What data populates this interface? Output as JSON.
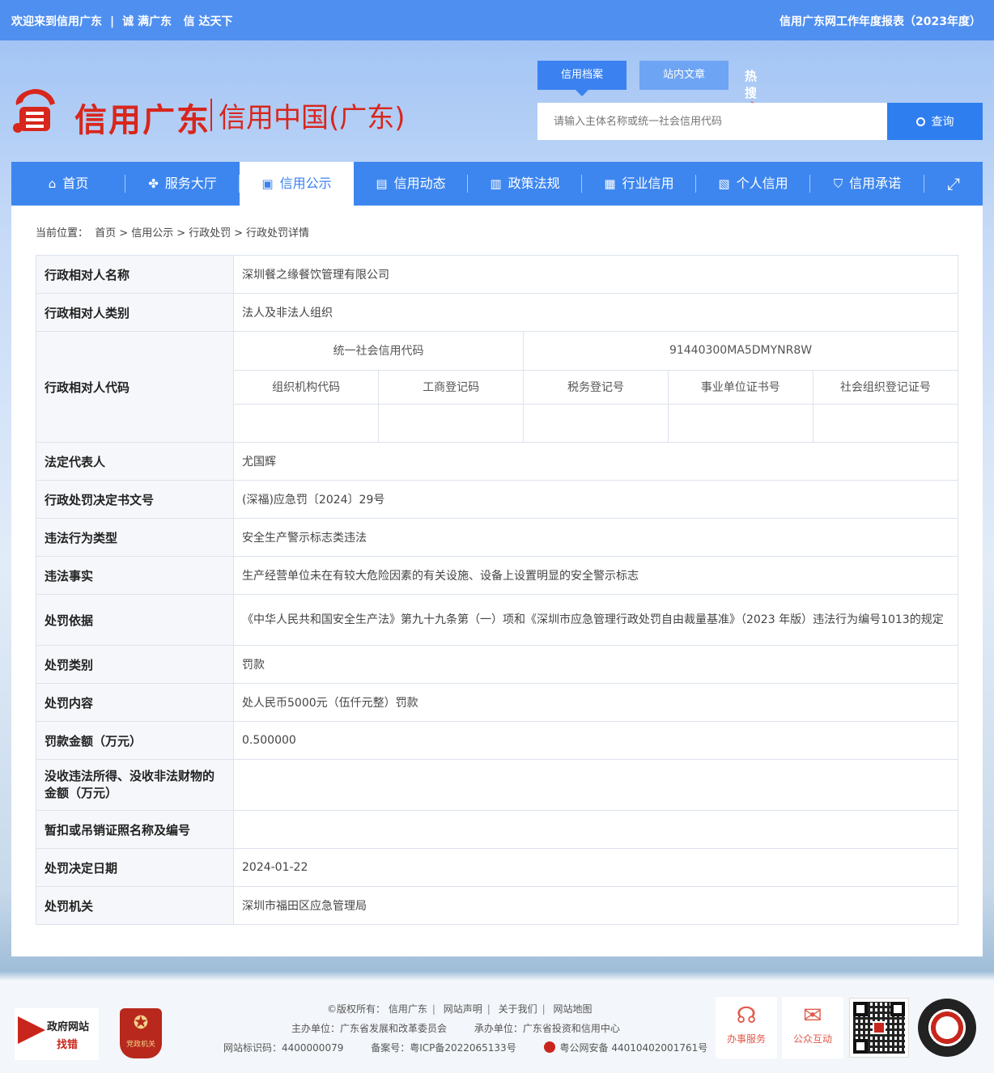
{
  "topbar": {
    "welcome": "欢迎来到信用广东",
    "slogan1": "诚 满广东",
    "slogan2": "信 达天下",
    "report_link": "信用广东网工作年度报表（2023年度）"
  },
  "logo": {
    "name": "信用广东",
    "sub": "信用中国(广东)"
  },
  "search": {
    "tab_active": "信用档案",
    "tab_other": "站内文章",
    "hot": "热搜",
    "placeholder": "请输入主体名称或统一社会信用代码",
    "button": "查询"
  },
  "nav": {
    "items": [
      {
        "label": "首页",
        "icon": "home-icon",
        "glyph": "⌂"
      },
      {
        "label": "服务大厅",
        "icon": "grid-icon",
        "glyph": "✤"
      },
      {
        "label": "信用公示",
        "icon": "briefcase-icon",
        "glyph": "▣"
      },
      {
        "label": "信用动态",
        "icon": "document-icon",
        "glyph": "▤"
      },
      {
        "label": "政策法规",
        "icon": "clipboard-icon",
        "glyph": "▥"
      },
      {
        "label": "行业信用",
        "icon": "building-icon",
        "glyph": "▦"
      },
      {
        "label": "个人信用",
        "icon": "id-card-icon",
        "glyph": "▧"
      },
      {
        "label": "信用承诺",
        "icon": "shield-icon",
        "glyph": "⛉"
      }
    ],
    "expand_icon": "expand-icon",
    "expand_glyph": "⤢"
  },
  "breadcrumb": {
    "prefix": "当前位置：",
    "items": [
      "首页",
      "信用公示",
      "行政处罚",
      "行政处罚详情"
    ],
    "sep": ">"
  },
  "record": {
    "name_label": "行政相对人名称",
    "name": "深圳餐之缘餐饮管理有限公司",
    "type_label": "行政相对人类别",
    "type": "法人及非法人组织",
    "code_label": "行政相对人代码",
    "uscc_label": "统一社会信用代码",
    "uscc": "91440300MA5DMYNR8W",
    "org_code_label": "组织机构代码",
    "biz_reg_label": "工商登记码",
    "tax_reg_label": "税务登记号",
    "inst_cert_label": "事业单位证书号",
    "social_org_label": "社会组织登记证号",
    "org_code": "",
    "biz_reg": "",
    "tax_reg": "",
    "inst_cert": "",
    "social_org": "",
    "legal_rep_label": "法定代表人",
    "legal_rep": "尤国辉",
    "doc_no_label": "行政处罚决定书文号",
    "doc_no": "(深福)应急罚〔2024〕29号",
    "violation_type_label": "违法行为类型",
    "violation_type": "安全生产警示标志类违法",
    "facts_label": "违法事实",
    "facts": "生产经营单位未在有较大危险因素的有关设施、设备上设置明显的安全警示标志",
    "basis_label": "处罚依据",
    "basis": "《中华人民共和国安全生产法》第九十九条第（一）项和《深圳市应急管理行政处罚自由裁量基准》（2023 年版）违法行为编号1013的规定",
    "category_label": "处罚类别",
    "category": "罚款",
    "content_label": "处罚内容",
    "content": "处人民币5000元（伍仟元整）罚款",
    "amount_label": "罚款金额（万元）",
    "amount": "0.500000",
    "confiscated_label": "没收违法所得、没收非法财物的金额（万元）",
    "confiscated": "",
    "license_label": "暂扣或吊销证照名称及编号",
    "license": "",
    "date_label": "处罚决定日期",
    "date": "2024-01-22",
    "authority_label": "处罚机关",
    "authority": "深圳市福田区应急管理局"
  },
  "footer": {
    "gov_find_1": "政府网站",
    "gov_find_2": "找错",
    "party_label": "党政机关",
    "copyright": "©版权所有：",
    "links": [
      "信用广东",
      "网站声明",
      "关于我们",
      "网站地图"
    ],
    "sponsor": "主办单位：广东省发展和改革委员会",
    "operator": "承办单位：广东省投资和信用中心",
    "site_id": "网站标识码：4400000079",
    "icp": "备案号：粤ICP备2022065133号",
    "police": "粤公网安备 44010402001761号",
    "service_1": "办事服务",
    "service_2": "公众互动"
  },
  "colors": {
    "primary": "#3d86ef",
    "topbar": "#4f8ff0",
    "brand_red": "#d8261c"
  }
}
